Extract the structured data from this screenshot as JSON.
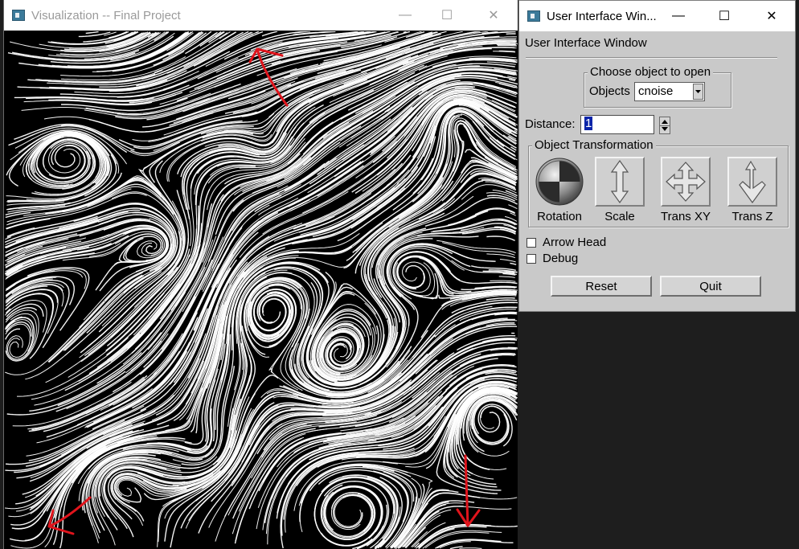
{
  "vis_window": {
    "title": "Visualization -- Final Project",
    "controls": {
      "minimize": "—",
      "maximize": "☐",
      "close": "✕"
    }
  },
  "ui_window": {
    "title": "User Interface Win...",
    "controls": {
      "minimize": "—",
      "maximize": "☐",
      "close": "✕"
    },
    "heading": "User Interface Window",
    "open_group": {
      "legend": "Choose object to open",
      "objects_label": "Objects",
      "objects_value": "cnoise"
    },
    "distance": {
      "label": "Distance:",
      "value": "1"
    },
    "transform_group": {
      "legend": "Object Transformation",
      "tools": [
        {
          "label": "Rotation",
          "icon": "rotation-sphere-icon"
        },
        {
          "label": "Scale",
          "icon": "scale-arrow-icon"
        },
        {
          "label": "Trans XY",
          "icon": "move-xy-icon"
        },
        {
          "label": "Trans Z",
          "icon": "trans-z-icon"
        }
      ]
    },
    "checkboxes": [
      {
        "label": "Arrow Head",
        "checked": false
      },
      {
        "label": "Debug",
        "checked": false
      }
    ],
    "buttons": {
      "reset": "Reset",
      "quit": "Quit"
    }
  },
  "colors": {
    "annotation_arrow": "#e0141c",
    "canvas_bg": "#000000",
    "streamline": "#ffffff",
    "panel_bg": "#c9c9c9"
  }
}
